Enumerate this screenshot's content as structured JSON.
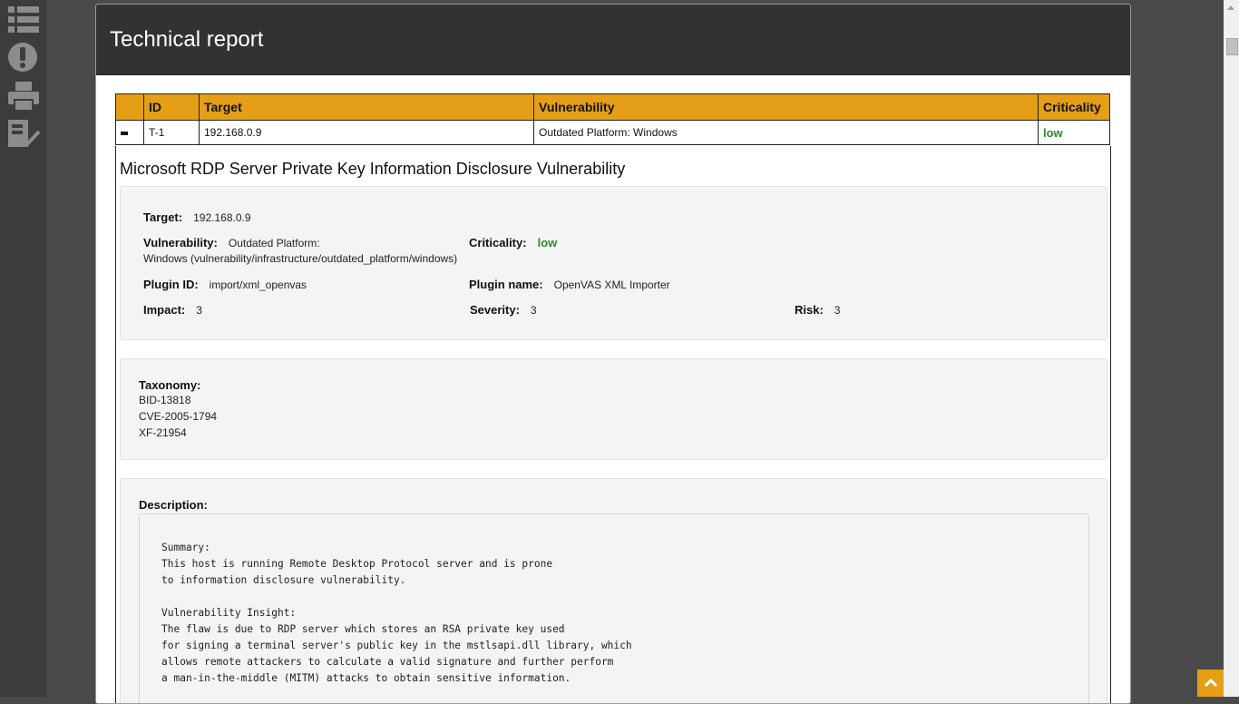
{
  "sidebar": {
    "icons": [
      {
        "name": "list-icon"
      },
      {
        "name": "alert-icon"
      },
      {
        "name": "printer-icon"
      },
      {
        "name": "report-check-icon"
      }
    ]
  },
  "header": {
    "title": "Technical report"
  },
  "table": {
    "columns": [
      "",
      "ID",
      "Target",
      "Vulnerability",
      "Criticality"
    ],
    "row": {
      "id": "T-1",
      "target": "192.168.0.9",
      "vulnerability": "Outdated Platform: Windows",
      "criticality": "low"
    }
  },
  "detail": {
    "title": "Microsoft RDP Server Private Key Information Disclosure Vulnerability",
    "target_label": "Target:",
    "target_value": "192.168.0.9",
    "vulnerability_label": "Vulnerability:",
    "vulnerability_value_1": "Outdated Platform:",
    "vulnerability_value_2": "Windows (vulnerability/infrastructure/outdated_platform/windows)",
    "criticality_label": "Criticality:",
    "criticality_value": "low",
    "plugin_id_label": "Plugin ID:",
    "plugin_id_value": "import/xml_openvas",
    "plugin_name_label": "Plugin name:",
    "plugin_name_value": "OpenVAS XML Importer",
    "impact_label": "Impact:",
    "impact_value": "3",
    "severity_label": "Severity:",
    "severity_value": "3",
    "risk_label": "Risk:",
    "risk_value": "3",
    "taxonomy_label": "Taxonomy:",
    "taxonomy": [
      "BID-13818",
      "CVE-2005-1794",
      "XF-21954"
    ],
    "description_label": "Description:",
    "description": "Summary:\nThis host is running Remote Desktop Protocol server and is prone\nto information disclosure vulnerability.\n\nVulnerability Insight:\nThe flaw is due to RDP server which stores an RSA private key used\nfor signing a terminal server's public key in the mstlsapi.dll library, which\nallows remote attackers to calculate a valid signature and further perform\na man-in-the-middle (MITM) attacks to obtain sensitive information."
  },
  "colors": {
    "accent": "#e49f17",
    "low": "#2a8a2a",
    "header_bg": "#323232"
  },
  "back_to_top_icon": "chevron-up-icon"
}
